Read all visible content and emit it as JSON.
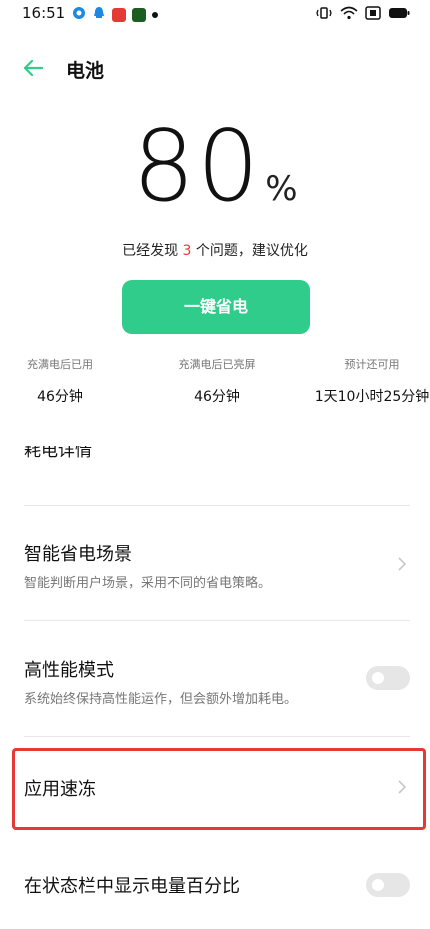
{
  "status_bar": {
    "time": "16:51",
    "icons_left": [
      "target-icon",
      "qq-icon",
      "music-app-icon",
      "green-app-icon",
      "dot-icon"
    ],
    "icons_right": [
      "vibrate-icon",
      "wifi-icon",
      "sim-icon",
      "battery-icon"
    ]
  },
  "header": {
    "title": "电池"
  },
  "battery": {
    "percent": "80",
    "percent_symbol": "%",
    "found_prefix": "已经发现",
    "found_count": "3",
    "found_suffix": "个问题，建议优化"
  },
  "save_button": {
    "label": "一键省电"
  },
  "stats": [
    {
      "label": "充满电后已用",
      "value": "46分钟"
    },
    {
      "label": "充满电后已亮屏",
      "value": "46分钟"
    },
    {
      "label": "预计还可用",
      "value": "1天10小时25分钟"
    }
  ],
  "list": {
    "cut_item": "耗电详情",
    "items": [
      {
        "title": "智能省电场景",
        "subtitle": "智能判断用户场景，采用不同的省电策略。"
      },
      {
        "title": "高性能模式",
        "subtitle": "系统始终保持高性能运作，但会额外增加耗电。"
      },
      {
        "title": "应用速冻"
      },
      {
        "title": "在状态栏中显示电量百分比"
      }
    ]
  },
  "colors": {
    "accent": "#2fcc8b",
    "highlight": "#e53935"
  }
}
